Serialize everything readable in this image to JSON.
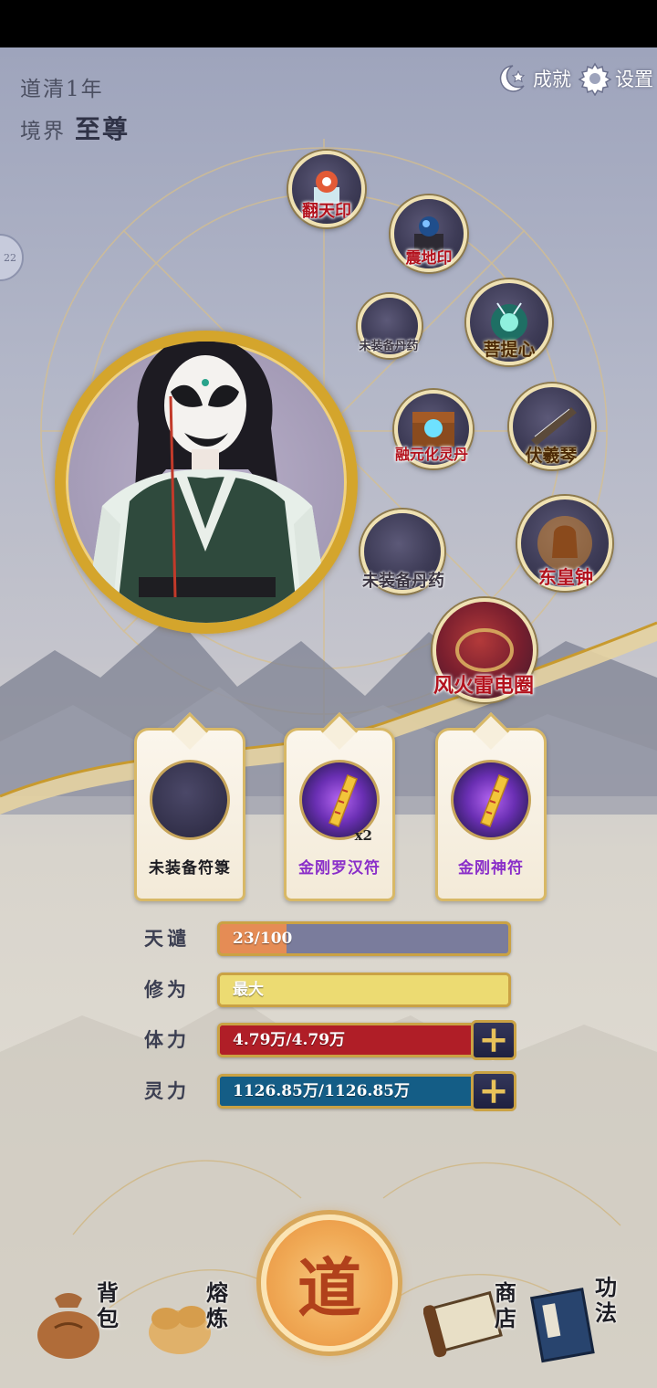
{
  "header": {
    "time": "道清1年",
    "realm_label": "境界",
    "realm_value": "至尊",
    "achievements": "成就",
    "settings": "设置",
    "side_tab": "22"
  },
  "artifacts": [
    {
      "label": "翻天印",
      "equipped": true
    },
    {
      "label": "震地印",
      "equipped": true
    },
    {
      "label": "未装备丹药",
      "equipped": false
    },
    {
      "label": "菩提心",
      "equipped": true
    },
    {
      "label": "融元化灵丹",
      "equipped": true
    },
    {
      "label": "伏羲琴",
      "equipped": true
    },
    {
      "label": "未装备丹药",
      "equipped": false
    },
    {
      "label": "东皇钟",
      "equipped": true
    },
    {
      "label": "风火雷电圈",
      "equipped": true
    }
  ],
  "talismans": [
    {
      "label": "未装备符箓",
      "count": "",
      "color": "#1c1c22"
    },
    {
      "label": "金刚罗汉符",
      "count": "x2",
      "color": "#8a2fc9"
    },
    {
      "label": "金刚神符",
      "count": "",
      "color": "#8a2fc9"
    }
  ],
  "stats": [
    {
      "name": "天谴",
      "value": "23/100",
      "fill": 0.23,
      "bg": "#7a7c9c",
      "fillColor": "#e58c55"
    },
    {
      "name": "修为",
      "value": "最大",
      "fill": 1.0,
      "bg": "#ecdb72",
      "fillColor": "#ecdb72"
    },
    {
      "name": "体力",
      "value": "4.79万/4.79万",
      "fill": 1.0,
      "bg": "#b01e27",
      "fillColor": "#b01e27"
    },
    {
      "name": "灵力",
      "value": "1126.85万/1126.85万",
      "fill": 1.0,
      "bg": "#145d86",
      "fillColor": "#145d86"
    }
  ],
  "nav": {
    "bag": "背包",
    "refine": "熔炼",
    "dao": "道",
    "shop": "商店",
    "skills": "功法"
  }
}
